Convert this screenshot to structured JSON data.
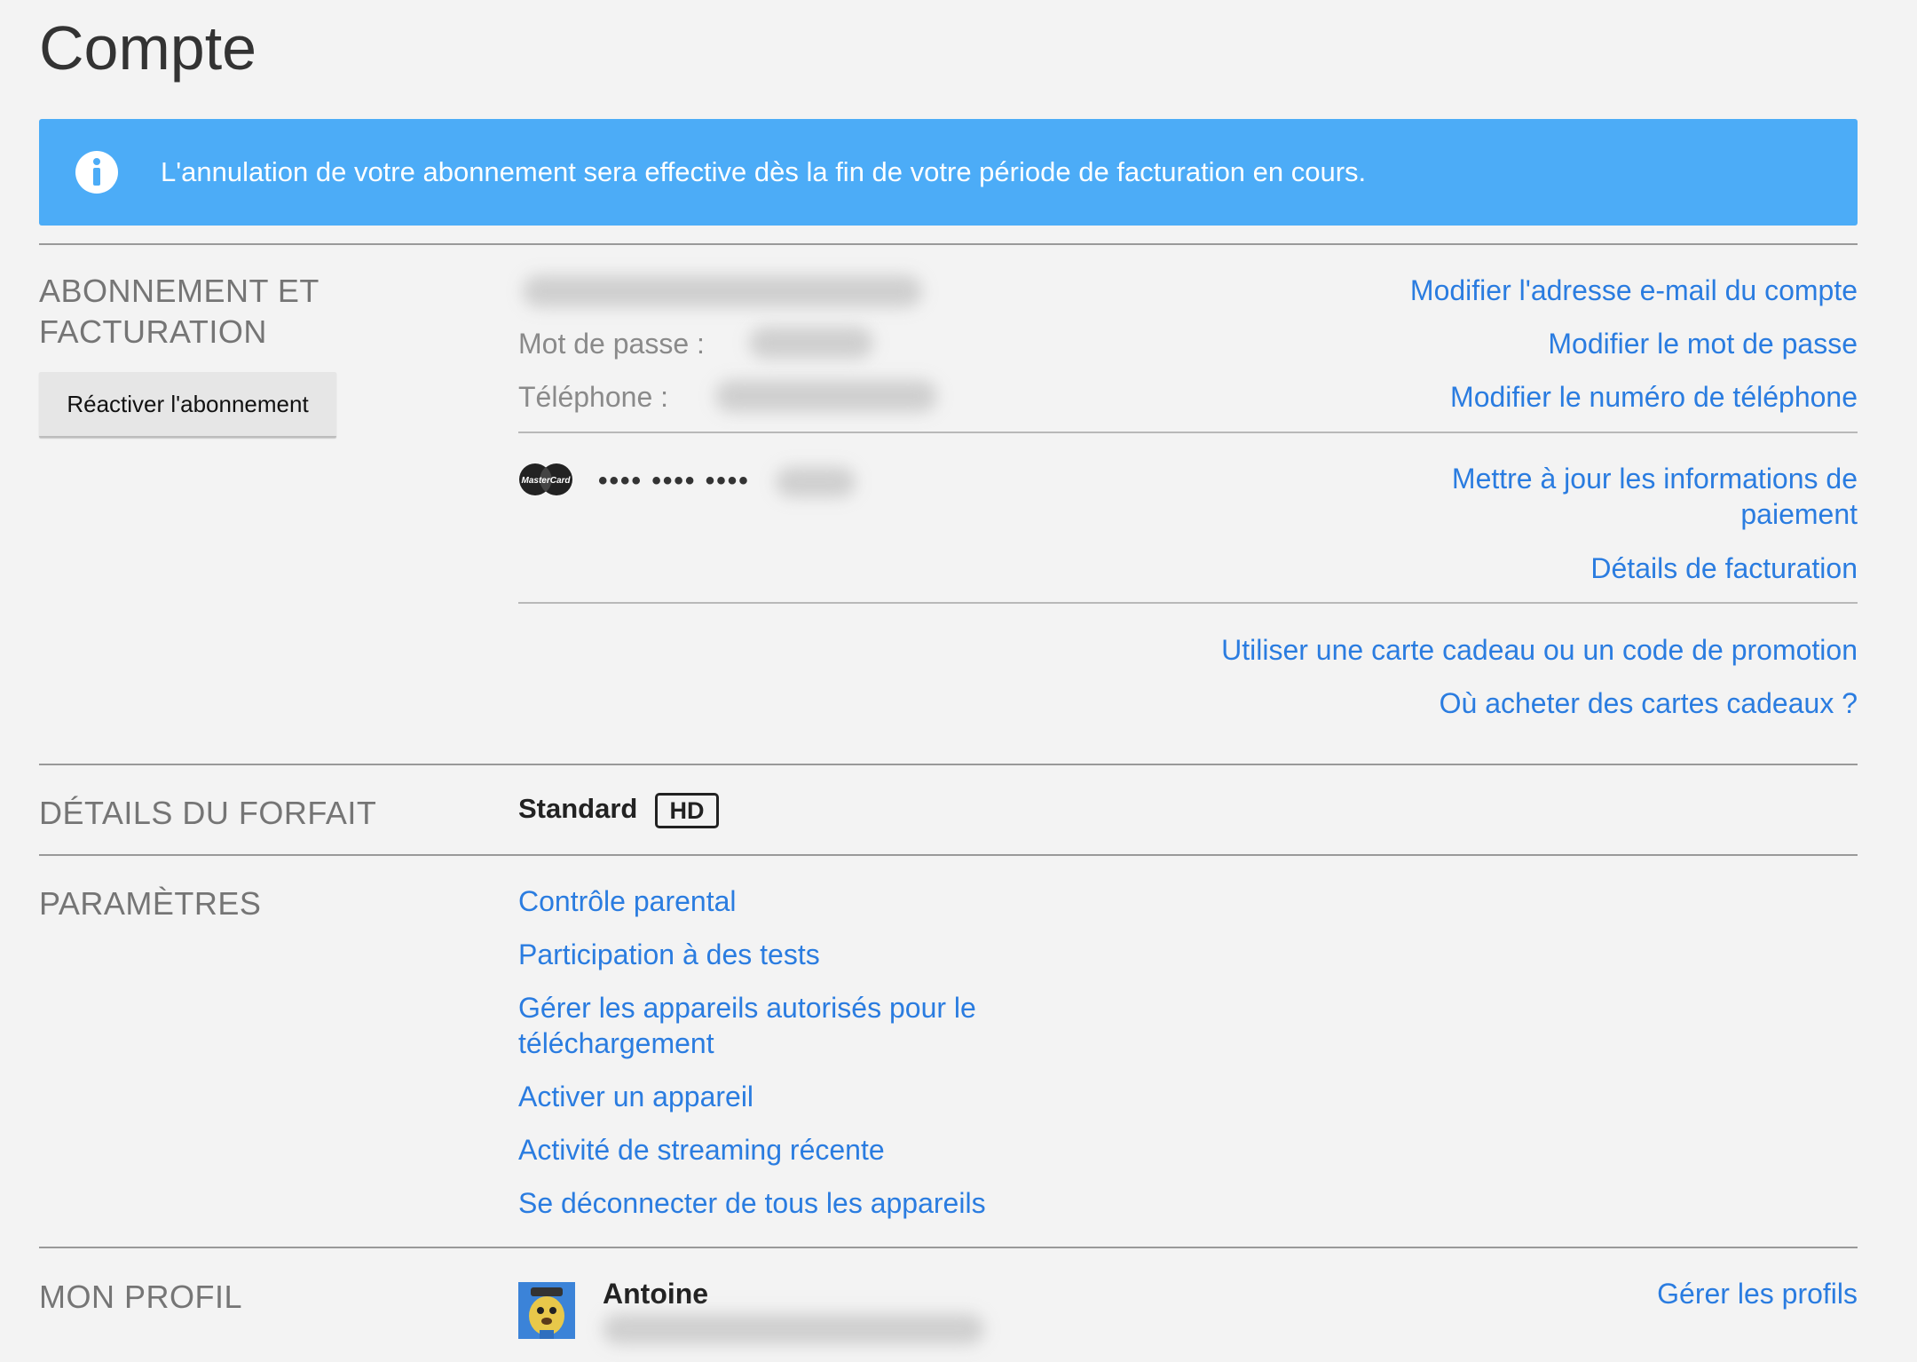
{
  "page": {
    "title": "Compte"
  },
  "banner": {
    "icon": "info-icon",
    "message": "L'annulation de votre abonnement sera effective dès la fin de votre période de facturation en cours.",
    "color": "#4cacf7"
  },
  "membership": {
    "section_title_line1": "ABONNEMENT ET",
    "section_title_line2": "FACTURATION",
    "reactivate_button": "Réactiver l'abonnement",
    "password_label": "Mot de passe :",
    "phone_label": "Téléphone :",
    "links": {
      "change_email": "Modifier l'adresse e-mail du compte",
      "change_password": "Modifier le mot de passe",
      "change_phone": "Modifier le numéro de téléphone",
      "update_payment_line1": "Mettre à jour les informations de",
      "update_payment_line2": "paiement",
      "billing_details": "Détails de facturation",
      "gift_card": "Utiliser une carte cadeau ou un code de promotion",
      "where_buy": "Où acheter des cartes cadeaux ?"
    },
    "card_icon": "mastercard-icon",
    "card_brand": "MasterCard",
    "card_mask": "•••• •••• ••••"
  },
  "plan": {
    "section_title": "DÉTAILS DU FORFAIT",
    "name": "Standard",
    "badge": "HD"
  },
  "settings": {
    "section_title": "PARAMÈTRES",
    "items": [
      {
        "label": "Contrôle parental"
      },
      {
        "label": "Participation à des tests"
      },
      {
        "label": "Gérer les appareils autorisés pour le"
      },
      {
        "label": "téléchargement"
      },
      {
        "label": "Activer un appareil"
      },
      {
        "label": "Activité de streaming récente"
      },
      {
        "label": "Se déconnecter de tous les appareils"
      }
    ]
  },
  "profile": {
    "section_title": "MON PROFIL",
    "name": "Antoine",
    "manage_link": "Gérer les profils",
    "avatar_icon": "avatar-icon"
  },
  "colors": {
    "link": "#2a7ce0",
    "background": "#f3f3f3"
  }
}
